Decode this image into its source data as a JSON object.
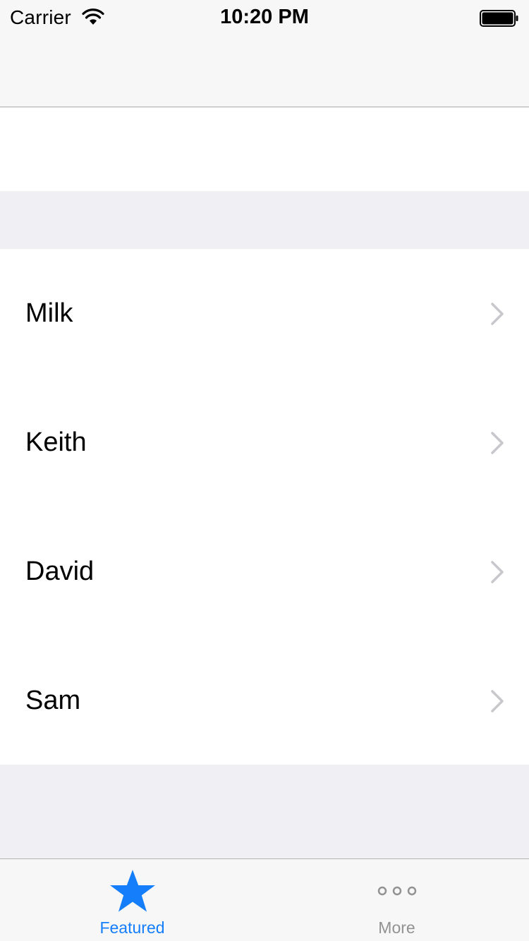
{
  "status_bar": {
    "carrier": "Carrier",
    "time": "10:20 PM"
  },
  "table": {
    "rows": [
      {
        "label": "Milk"
      },
      {
        "label": "Keith"
      },
      {
        "label": "David"
      },
      {
        "label": "Sam"
      }
    ]
  },
  "tab_bar": {
    "tabs": [
      {
        "label": "Featured",
        "icon": "star-icon",
        "selected": true
      },
      {
        "label": "More",
        "icon": "more-icon",
        "selected": false
      }
    ]
  },
  "colors": {
    "accent": "#147efb",
    "inactive": "#929292",
    "chevron": "#c7c7cc",
    "grouped_background": "#efeff4",
    "bar_background": "#f7f7f7"
  }
}
